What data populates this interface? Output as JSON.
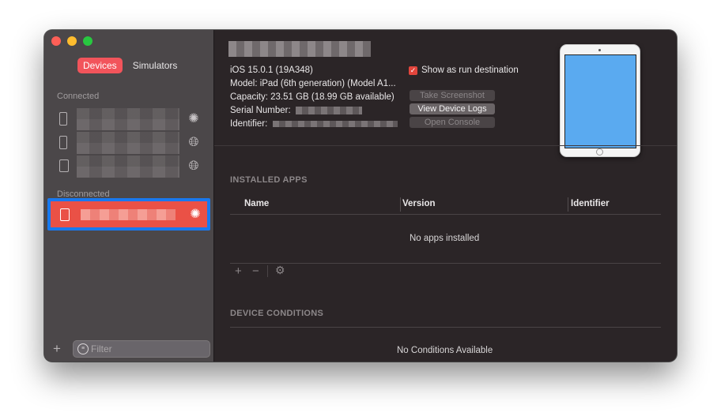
{
  "sidebar": {
    "tabs": [
      {
        "label": "Devices",
        "active": true
      },
      {
        "label": "Simulators",
        "active": false
      }
    ],
    "connected_label": "Connected",
    "disconnected_label": "Disconnected",
    "filter_placeholder": "Filter",
    "add_symbol": "+"
  },
  "device": {
    "ios": "iOS 15.0.1 (19A348)",
    "model": "Model: iPad (6th generation) (Model A1...",
    "capacity": "Capacity: 23.51 GB (18.99 GB available)",
    "serial_label": "Serial Number:",
    "identifier_label": "Identifier:",
    "show_run_destination": "Show as run destination",
    "buttons": {
      "screenshot": "Take Screenshot",
      "logs": "View Device Logs",
      "console": "Open Console"
    }
  },
  "installed_apps": {
    "heading": "INSTALLED APPS",
    "columns": [
      "Name",
      "Version",
      "Identifier"
    ],
    "empty": "No apps installed",
    "toolbar": {
      "add": "+",
      "remove": "−",
      "gear": "⚙"
    }
  },
  "device_conditions": {
    "heading": "DEVICE CONDITIONS",
    "empty": "No Conditions Available"
  },
  "colors": {
    "accent_red": "#f2545b",
    "selection_blue": "#1979ef",
    "sidebar_bg": "#4b4749",
    "main_bg": "#2b2527"
  }
}
